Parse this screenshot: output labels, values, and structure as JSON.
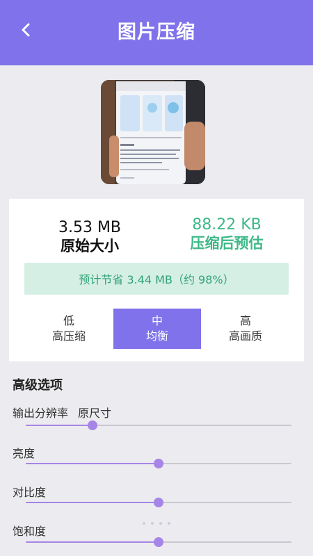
{
  "header": {
    "title": "图片压缩",
    "background": "#7f72ea",
    "back_icon": "chevron-left-icon"
  },
  "preview": {
    "screen_lines": [
      "【智能优惠卷助手】",
      "【免费优惠资格】",
      "【免费领取】"
    ]
  },
  "stats": {
    "original_size": "3.53 MB",
    "original_label": "原始大小",
    "compressed_size": "88.22 KB",
    "compressed_label": "压缩后预估",
    "accent_green": "#3db888"
  },
  "saving": {
    "text": "预计节省 3.44 MB（约 98%）"
  },
  "levels": [
    {
      "title": "低",
      "subtitle": "高压缩",
      "selected": false
    },
    {
      "title": "中",
      "subtitle": "均衡",
      "selected": true
    },
    {
      "title": "高",
      "subtitle": "高画质",
      "selected": false
    }
  ],
  "advanced": {
    "title": "高级选项",
    "resolution_label": "输出分辨率",
    "resolution_value": "原尺寸",
    "sliders": [
      {
        "label": "亮度",
        "value": 0.5
      },
      {
        "label": "对比度",
        "value": 0.5
      },
      {
        "label": "饱和度",
        "value": 0.5
      }
    ],
    "resolution_slider_value": 0.25,
    "slider_color": "#a585e8"
  }
}
